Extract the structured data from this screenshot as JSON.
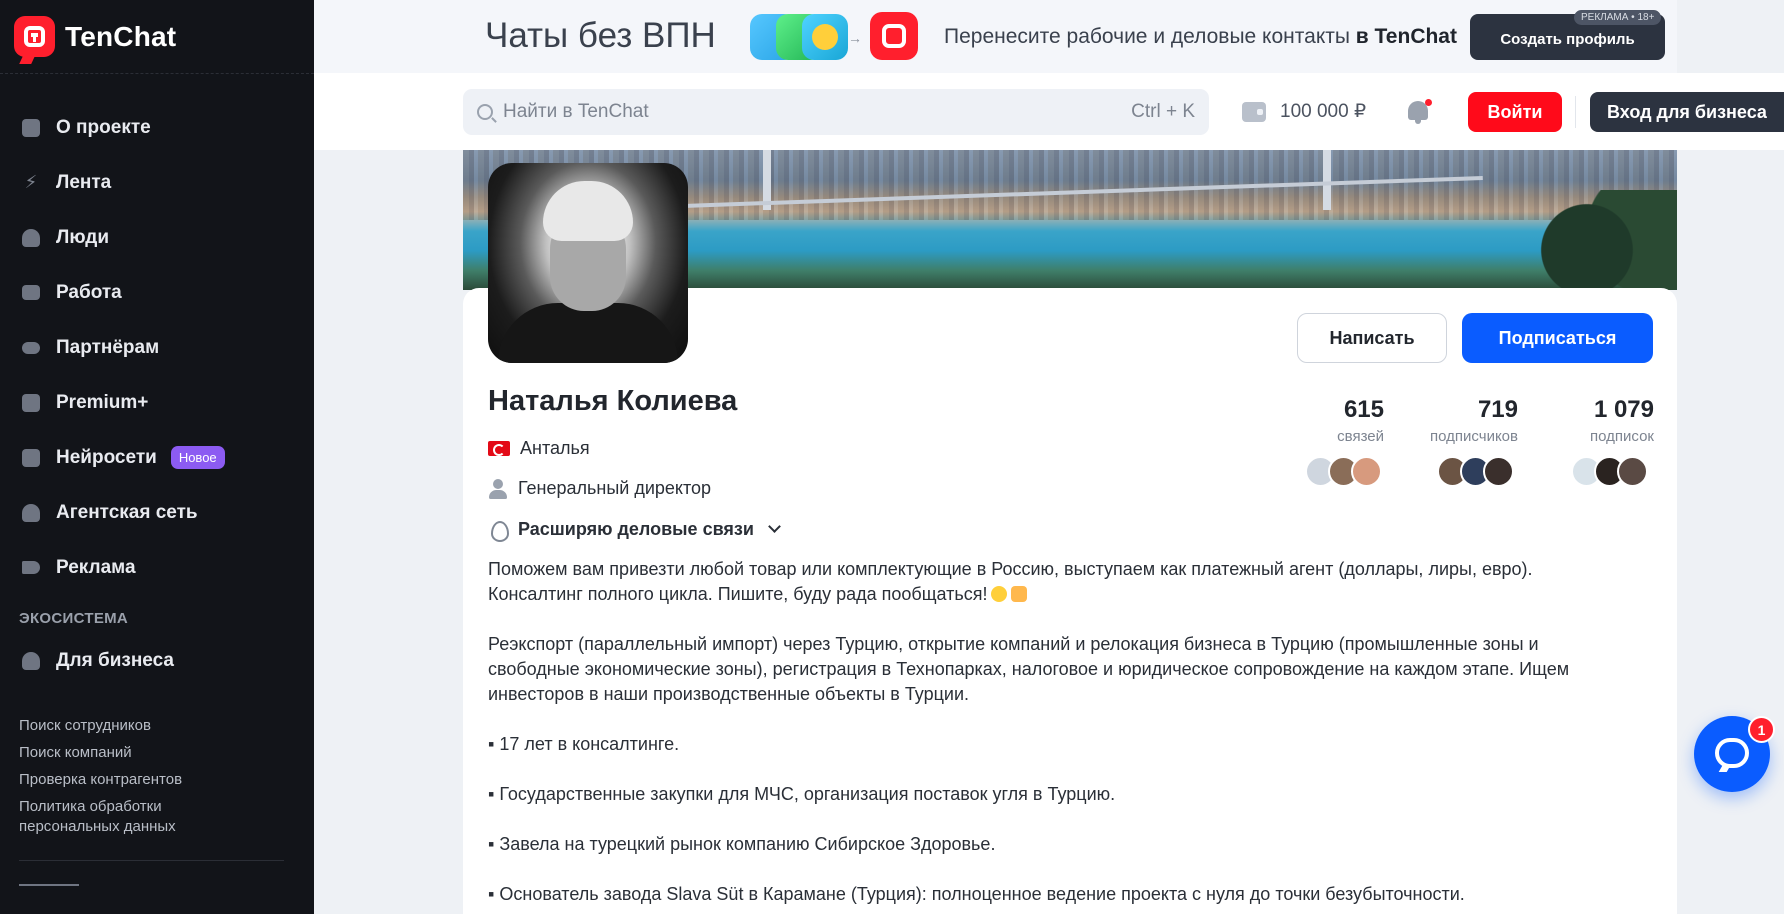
{
  "app": {
    "name": "TenChat"
  },
  "sidebar": {
    "items": [
      {
        "label": "О проекте",
        "icon": "info-icon"
      },
      {
        "label": "Лента",
        "icon": "lightning-icon"
      },
      {
        "label": "Люди",
        "icon": "people-icon"
      },
      {
        "label": "Работа",
        "icon": "briefcase-icon"
      },
      {
        "label": "Партнёрам",
        "icon": "handshake-icon"
      },
      {
        "label": "Premium+",
        "icon": "premium-icon"
      },
      {
        "label": "Нейросети",
        "icon": "ai-icon",
        "badge": "Новое"
      },
      {
        "label": "Агентская сеть",
        "icon": "network-icon"
      },
      {
        "label": "Реклама",
        "icon": "megaphone-icon"
      }
    ],
    "ecosystem_label": "ЭКОСИСТЕМА",
    "business_label": "Для бизнеса",
    "footer_links": [
      "Поиск сотрудников",
      "Поиск компаний",
      "Проверка контрагентов",
      "Политика обработки",
      "персональных данных"
    ]
  },
  "ad_banner": {
    "title": "Чаты без ВПН",
    "text": "Перенесите рабочие и деловые контакты ",
    "text_bold": "в TenChat",
    "button": "Создать профиль",
    "badge": "РЕКЛАМА • 18+"
  },
  "header": {
    "search_placeholder": "Найти в TenChat",
    "search_shortcut": "Ctrl + K",
    "balance": "100 000 ₽",
    "login": "Войти",
    "business_login": "Вход для бизнеса"
  },
  "profile": {
    "name": "Наталья Колиева",
    "city": "Анталья",
    "position": "Генеральный директор",
    "status": "Расширяю деловые связи",
    "write_button": "Написать",
    "subscribe_button": "Подписаться",
    "stats": [
      {
        "value": "615",
        "label": "связей"
      },
      {
        "value": "719",
        "label": "подписчиков"
      },
      {
        "value": "1 079",
        "label": "подписок"
      }
    ],
    "bio": [
      "Поможем вам привезти любой товар или комплектующие в Россию, выступаем как платежный агент (доллары, лиры, евро).",
      "Консалтинг полного цикла. Пишите, буду рада пообщаться!",
      "Реэкспорт (параллельный импорт) через Турцию, открытие компаний и релокация бизнеса в Турцию (промышленные зоны и",
      "свободные экономические зоны), регистрация в Технопарках, налоговое и юридическое сопровождение на каждом этапе. Ищем",
      "инвесторов в наши производственные объекты в Турции.",
      "▪ 17 лет в консалтинге.",
      "▪ Государственные закупки для МЧС, организация поставок угля в Турцию.",
      "▪  Завела на турецкий рынок компанию Сибирское Здоровье.",
      "▪  Основатель завода Slava Süt в Карамане (Турция): полноценное ведение проекта с нуля до точки безубыточности."
    ]
  },
  "chat": {
    "unread": "1"
  }
}
